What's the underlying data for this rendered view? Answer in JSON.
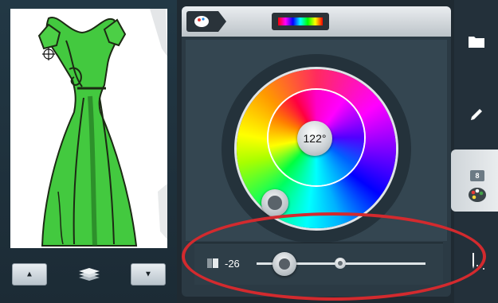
{
  "canvas": {
    "left_button_icon": "triangle-up-icon",
    "layers_icon": "layers-icon",
    "right_button_icon": "triangle-down-icon",
    "up_glyph": "▲",
    "down_glyph": "▼"
  },
  "header": {
    "palette_icon": "palette-icon",
    "spectrum_icon": "spectrum-icon"
  },
  "color_wheel": {
    "hue_label": "122°"
  },
  "brightness": {
    "value": "-26",
    "icon": "brightness-icon"
  },
  "sidebar": {
    "items": [
      {
        "name": "folder",
        "icon": "folder-icon"
      },
      {
        "name": "edit",
        "icon": "pencil-icon"
      },
      {
        "name": "color",
        "icon": "palette-icon",
        "badge": "8"
      },
      {
        "name": "stitch",
        "icon": "needle-icon"
      }
    ]
  },
  "colors": {
    "highlight": "#d32a2e",
    "dress": "#39c83a"
  }
}
